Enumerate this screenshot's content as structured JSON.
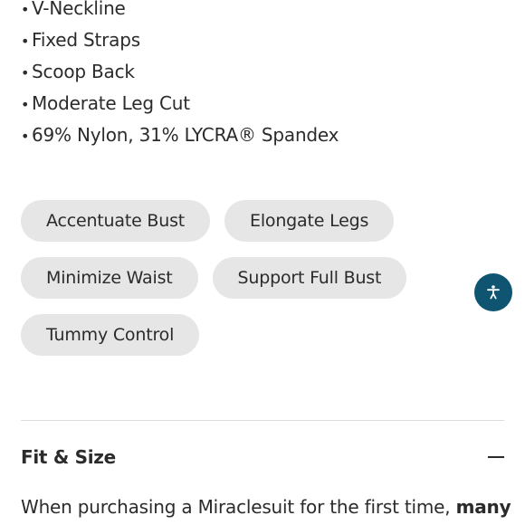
{
  "features": [
    "V-Neckline",
    "Fixed Straps",
    "Scoop Back",
    "Moderate Leg Cut",
    "69% Nylon, 31% LYCRA® Spandex"
  ],
  "bullet_char": "•",
  "tags": {
    "row1": [
      "Accentuate Bust",
      "Elongate Legs"
    ],
    "row2": [
      "Minimize Waist",
      "Support Full Bust"
    ],
    "row3": [
      "Tummy Control"
    ]
  },
  "accessibility_button": {
    "icon": "accessibility-person-icon",
    "color": "#0f5571"
  },
  "fit_section": {
    "title": "Fit & Size",
    "state_icon": "minus-icon",
    "text_start": "When purchasing a Miraclesuit for the first time,",
    "text_bold": "many"
  },
  "colors": {
    "tag_background": "#e6e6e6",
    "text": "#2b2b2b",
    "divider": "#dddddd"
  }
}
